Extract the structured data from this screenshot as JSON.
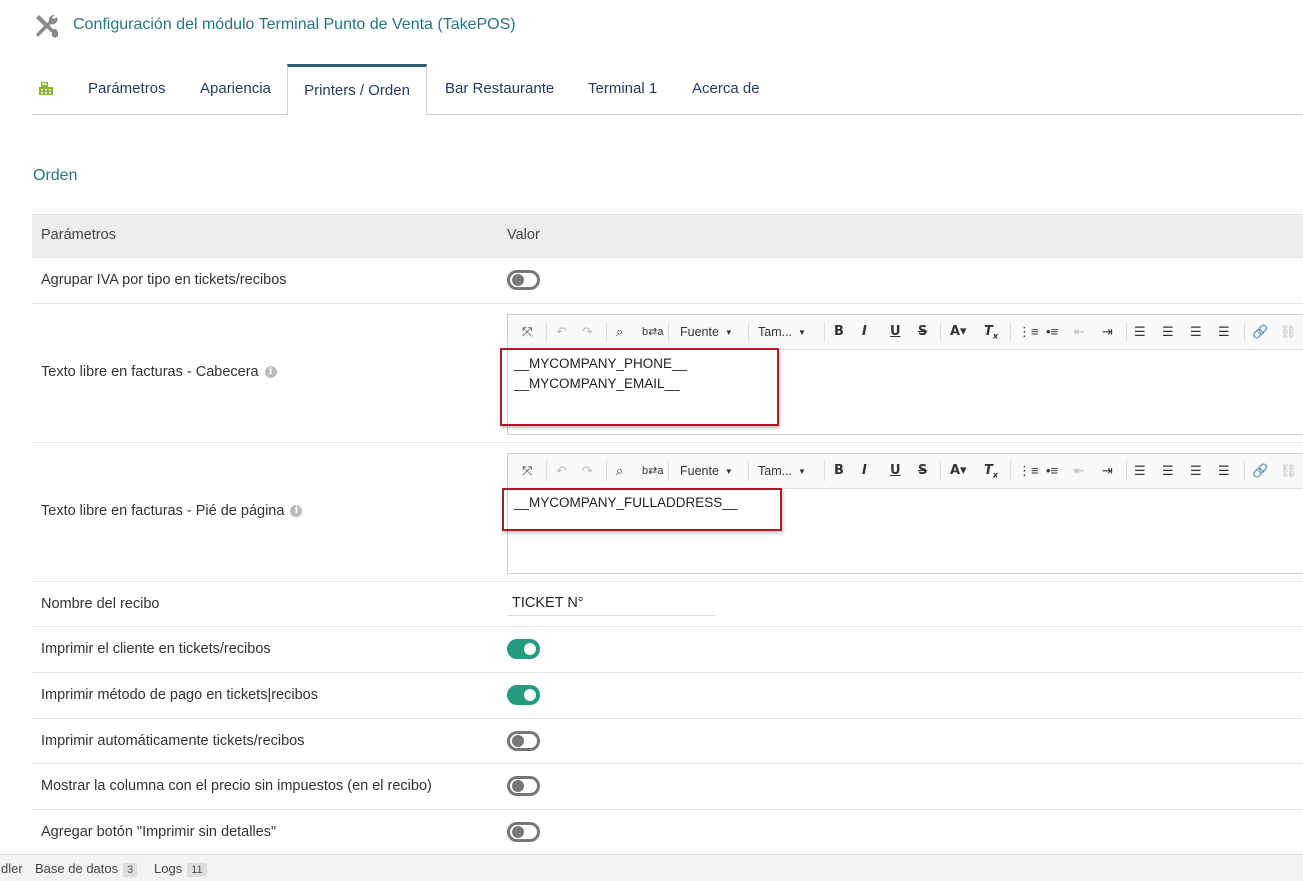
{
  "header": {
    "title": "Configuración del módulo Terminal Punto de Venta (TakePOS)",
    "icon": "tools-icon"
  },
  "tabs": [
    {
      "label": "Parámetros"
    },
    {
      "label": "Apariencia"
    },
    {
      "label": "Printers / Orden",
      "active": true
    },
    {
      "label": "Bar Restaurante"
    },
    {
      "label": "Terminal 1"
    },
    {
      "label": "Acerca de"
    }
  ],
  "section": {
    "title": "Orden"
  },
  "table": {
    "headers": {
      "param": "Parámetros",
      "value": "Valor"
    },
    "rows": [
      {
        "label": "Agrupar IVA por tipo en tickets/recibos",
        "type": "toggle",
        "enabled": false
      },
      {
        "label": "Texto libre en facturas - Cabecera",
        "type": "editor",
        "lines": [
          "__MYCOMPANY_PHONE__",
          "__MYCOMPANY_EMAIL__"
        ]
      },
      {
        "label": "Texto libre en facturas - Pié de página",
        "type": "editor",
        "lines": [
          "__MYCOMPANY_FULLADDRESS__"
        ]
      },
      {
        "label": "Nombre del recibo",
        "type": "text",
        "value": "TICKET N°"
      },
      {
        "label": "Imprimir el cliente en tickets/recibos",
        "type": "toggle",
        "enabled": true
      },
      {
        "label": "Imprimir método de pago en tickets|recibos",
        "type": "toggle",
        "enabled": true
      },
      {
        "label": "Imprimir automáticamente tickets/recibos",
        "type": "toggle",
        "enabled": false
      },
      {
        "label": "Mostrar la columna con el precio sin impuestos (en el recibo)",
        "type": "toggle",
        "enabled": false
      },
      {
        "label": "Agregar botón \"Imprimir sin detalles\"",
        "type": "toggle",
        "enabled": false
      }
    ]
  },
  "editor_toolbar": {
    "font_label": "Fuente",
    "size_label": "Tam..."
  },
  "footer": {
    "items": [
      {
        "label": "dler"
      },
      {
        "label": "Base de datos",
        "badge": "3"
      },
      {
        "label": "Logs",
        "badge": "11"
      }
    ]
  },
  "colors": {
    "accent": "#26767d",
    "toggle_on": "#239b7c",
    "highlight_box": "#b01a25"
  }
}
